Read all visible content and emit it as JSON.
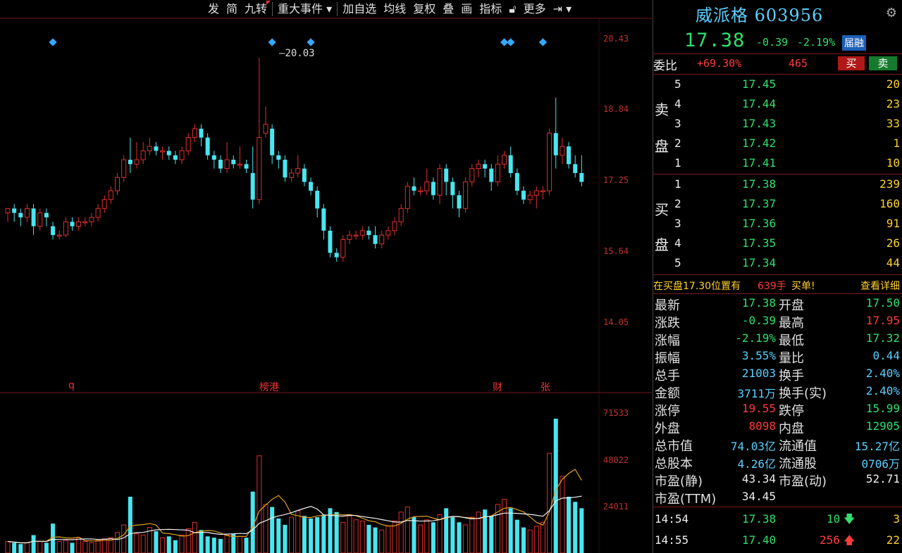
{
  "toolbar": {
    "items": [
      "发",
      "简",
      "九转",
      "重大事件",
      "加自选",
      "均线",
      "复权",
      "叠",
      "画",
      "指标",
      "更多"
    ],
    "dropdown_icon": "chevron-down-icon",
    "lock_icon": "lock-icon",
    "exit_icon": "exit-icon"
  },
  "header": {
    "stock_name": "威派格",
    "stock_code": "603956",
    "price": "17.38",
    "change": "-0.39",
    "change_pct": "-2.19%",
    "badge": "届融"
  },
  "order_book": {
    "weibi_label": "委比",
    "weibi_pct": "+69.30%",
    "weicha": "465",
    "buy_btn": "买",
    "sell_btn": "卖",
    "sell_side_label_1": "卖",
    "sell_side_label_2": "盘",
    "buy_side_label_1": "买",
    "buy_side_label_2": "盘",
    "asks": [
      {
        "level": "5",
        "price": "17.45",
        "vol": "20"
      },
      {
        "level": "4",
        "price": "17.44",
        "vol": "23"
      },
      {
        "level": "3",
        "price": "17.43",
        "vol": "33"
      },
      {
        "level": "2",
        "price": "17.42",
        "vol": "1"
      },
      {
        "level": "1",
        "price": "17.41",
        "vol": "10"
      }
    ],
    "bids": [
      {
        "level": "1",
        "price": "17.38",
        "vol": "239"
      },
      {
        "level": "2",
        "price": "17.37",
        "vol": "160"
      },
      {
        "level": "3",
        "price": "17.36",
        "vol": "91"
      },
      {
        "level": "4",
        "price": "17.35",
        "vol": "26"
      },
      {
        "level": "5",
        "price": "17.34",
        "vol": "44"
      }
    ]
  },
  "notice": {
    "prefix": "在买盘17.30位置有",
    "amount": "639手",
    "suffix": "买单!",
    "link": "查看详细"
  },
  "stats": [
    {
      "k": "最新",
      "v": "17.38",
      "c": "green"
    },
    {
      "k": "开盘",
      "v": "17.50",
      "c": "green"
    },
    {
      "k": "涨跌",
      "v": "-0.39",
      "c": "green"
    },
    {
      "k": "最高",
      "v": "17.95",
      "c": "red"
    },
    {
      "k": "涨幅",
      "v": "-2.19%",
      "c": "green"
    },
    {
      "k": "最低",
      "v": "17.32",
      "c": "green"
    },
    {
      "k": "振幅",
      "v": "3.55%",
      "c": "blue"
    },
    {
      "k": "量比",
      "v": "0.44",
      "c": "blue"
    },
    {
      "k": "总手",
      "v": "21003",
      "c": "blue"
    },
    {
      "k": "换手",
      "v": "2.40%",
      "c": "blue"
    },
    {
      "k": "金额",
      "v": "3711万",
      "c": "blue"
    },
    {
      "k": "换手(实)",
      "v": "2.40%",
      "c": "blue"
    },
    {
      "k": "涨停",
      "v": "19.55",
      "c": "red"
    },
    {
      "k": "跌停",
      "v": "15.99",
      "c": "green"
    },
    {
      "k": "外盘",
      "v": "8098",
      "c": "red"
    },
    {
      "k": "内盘",
      "v": "12905",
      "c": "green"
    },
    {
      "k": "总市值",
      "v": "74.03亿",
      "c": "blue"
    },
    {
      "k": "流通值",
      "v": "15.27亿",
      "c": "blue"
    },
    {
      "k": "总股本",
      "v": "4.26亿",
      "c": "blue"
    },
    {
      "k": "流通股",
      "v": "0706万",
      "c": "blue"
    },
    {
      "k": "市盈(静)",
      "v": "43.34",
      "c": "white"
    },
    {
      "k": "市盈(动)",
      "v": "52.71",
      "c": "white"
    },
    {
      "k": "市盈(TTM)",
      "v": "34.45",
      "c": "white"
    }
  ],
  "ticks": [
    {
      "time": "14:54",
      "price": "17.38",
      "vol": "10",
      "dir": "down",
      "n": "3"
    },
    {
      "time": "14:55",
      "price": "17.40",
      "vol": "256",
      "dir": "up",
      "n": "22"
    }
  ],
  "chart": {
    "price_labels": [
      "20.43",
      "18.84",
      "17.25",
      "15.64",
      "14.05"
    ],
    "volume_labels": [
      "71533",
      "48022",
      "24011"
    ],
    "high_marker": "20.03",
    "event_labels": [
      "q",
      "榜港",
      "财",
      "张"
    ]
  },
  "chart_data": {
    "type": "candlestick",
    "price_axis_ticks": [
      20.43,
      18.84,
      17.25,
      15.64,
      14.05
    ],
    "volume_axis_ticks": [
      71533,
      48022,
      24011
    ],
    "highest_marker": 20.03,
    "candles": [
      [
        16.5,
        16.6,
        16.3,
        16.6
      ],
      [
        16.6,
        16.5,
        16.3,
        16.7
      ],
      [
        16.5,
        16.4,
        16.2,
        16.6
      ],
      [
        16.4,
        16.6,
        16.3,
        16.7
      ],
      [
        16.6,
        16.2,
        16.0,
        16.7
      ],
      [
        16.2,
        16.5,
        16.1,
        16.6
      ],
      [
        16.5,
        16.4,
        16.2,
        16.6
      ],
      [
        16.2,
        16.0,
        15.9,
        16.3
      ],
      [
        16.0,
        16.0,
        15.9,
        16.1
      ],
      [
        16.0,
        16.3,
        15.95,
        16.4
      ],
      [
        16.3,
        16.2,
        16.1,
        16.4
      ],
      [
        16.2,
        16.3,
        16.1,
        16.4
      ],
      [
        16.3,
        16.3,
        16.2,
        16.4
      ],
      [
        16.3,
        16.4,
        16.2,
        16.5
      ],
      [
        16.4,
        16.6,
        16.3,
        16.7
      ],
      [
        16.6,
        16.8,
        16.5,
        16.9
      ],
      [
        16.8,
        17.0,
        16.7,
        17.1
      ],
      [
        17.0,
        17.3,
        16.9,
        17.4
      ],
      [
        17.3,
        17.7,
        17.2,
        17.8
      ],
      [
        17.7,
        17.6,
        17.4,
        18.2
      ],
      [
        17.6,
        17.7,
        17.5,
        18.1
      ],
      [
        17.7,
        17.9,
        17.6,
        18.1
      ],
      [
        17.9,
        18.0,
        17.8,
        18.2
      ],
      [
        18.0,
        17.9,
        17.8,
        18.1
      ],
      [
        17.9,
        17.9,
        17.7,
        18.0
      ],
      [
        17.9,
        17.8,
        17.7,
        18.0
      ],
      [
        17.8,
        17.7,
        17.6,
        17.9
      ],
      [
        17.7,
        17.9,
        17.6,
        18.0
      ],
      [
        17.9,
        18.2,
        17.8,
        18.3
      ],
      [
        18.2,
        18.4,
        18.1,
        18.5
      ],
      [
        18.4,
        18.2,
        18.0,
        18.5
      ],
      [
        18.2,
        17.8,
        17.7,
        18.3
      ],
      [
        17.8,
        17.7,
        17.5,
        17.9
      ],
      [
        17.7,
        17.5,
        17.4,
        17.8
      ],
      [
        17.5,
        17.7,
        17.4,
        18.1
      ],
      [
        17.7,
        17.6,
        17.5,
        17.8
      ],
      [
        17.6,
        17.6,
        17.5,
        18.0
      ],
      [
        17.6,
        17.5,
        17.4,
        17.7
      ],
      [
        17.4,
        16.8,
        16.6,
        18.0
      ],
      [
        16.8,
        18.2,
        16.7,
        20.0
      ],
      [
        18.3,
        18.5,
        18.2,
        18.9
      ],
      [
        18.4,
        17.8,
        17.6,
        18.5
      ],
      [
        17.8,
        17.7,
        17.5,
        17.9
      ],
      [
        17.7,
        17.3,
        17.2,
        17.8
      ],
      [
        17.3,
        17.4,
        17.2,
        17.5
      ],
      [
        17.4,
        17.5,
        17.3,
        17.8
      ],
      [
        17.5,
        17.2,
        17.1,
        17.6
      ],
      [
        17.2,
        17.0,
        16.9,
        17.3
      ],
      [
        17.0,
        16.6,
        16.4,
        17.1
      ],
      [
        16.6,
        16.1,
        15.9,
        16.7
      ],
      [
        16.1,
        15.6,
        15.5,
        16.2
      ],
      [
        15.6,
        15.5,
        15.4,
        15.7
      ],
      [
        15.5,
        15.9,
        15.4,
        16.0
      ],
      [
        15.9,
        16.0,
        15.8,
        16.1
      ],
      [
        16.0,
        16.0,
        15.9,
        16.1
      ],
      [
        16.0,
        16.1,
        15.9,
        16.2
      ],
      [
        16.1,
        16.0,
        15.9,
        16.2
      ],
      [
        16.0,
        15.8,
        15.7,
        16.2
      ],
      [
        15.8,
        16.0,
        15.7,
        16.1
      ],
      [
        16.0,
        16.1,
        15.9,
        16.2
      ],
      [
        16.1,
        16.3,
        16.0,
        16.4
      ],
      [
        16.3,
        16.6,
        16.2,
        16.7
      ],
      [
        16.6,
        17.1,
        16.5,
        17.2
      ],
      [
        17.1,
        17.0,
        16.9,
        17.3
      ],
      [
        17.0,
        17.0,
        16.9,
        17.1
      ],
      [
        17.0,
        17.2,
        16.9,
        17.5
      ],
      [
        17.2,
        16.9,
        16.8,
        17.3
      ],
      [
        16.9,
        17.5,
        16.7,
        17.6
      ],
      [
        17.5,
        17.2,
        16.9,
        17.6
      ],
      [
        17.2,
        16.9,
        16.6,
        17.3
      ],
      [
        16.9,
        16.6,
        16.4,
        17.0
      ],
      [
        16.6,
        17.2,
        16.5,
        17.3
      ],
      [
        17.2,
        17.5,
        17.1,
        17.6
      ],
      [
        17.5,
        17.6,
        17.3,
        17.7
      ],
      [
        17.6,
        17.5,
        17.3,
        17.7
      ],
      [
        17.5,
        17.2,
        17.0,
        17.6
      ],
      [
        17.2,
        17.6,
        17.1,
        17.8
      ],
      [
        17.6,
        17.8,
        17.5,
        17.9
      ],
      [
        17.8,
        17.4,
        17.3,
        18.0
      ],
      [
        17.4,
        17.0,
        16.9,
        17.5
      ],
      [
        17.0,
        16.8,
        16.7,
        17.1
      ],
      [
        16.8,
        16.9,
        16.7,
        17.0
      ],
      [
        16.9,
        17.0,
        16.6,
        17.1
      ],
      [
        17.0,
        17.0,
        16.8,
        17.1
      ],
      [
        17.0,
        18.3,
        16.9,
        18.4
      ],
      [
        18.3,
        17.8,
        17.5,
        19.1
      ],
      [
        17.8,
        18.0,
        17.6,
        18.2
      ],
      [
        18.0,
        17.6,
        17.5,
        18.1
      ],
      [
        17.6,
        17.4,
        17.3,
        17.8
      ],
      [
        17.4,
        17.2,
        17.1,
        17.8
      ]
    ],
    "volumes": [
      9,
      8,
      7,
      8,
      14,
      9,
      8,
      23,
      9,
      10,
      8,
      12,
      9,
      8,
      10,
      11,
      12,
      16,
      22,
      44,
      15,
      14,
      20,
      17,
      12,
      13,
      10,
      14,
      19,
      24,
      18,
      13,
      12,
      11,
      14,
      15,
      13,
      12,
      48,
      76,
      38,
      36,
      27,
      22,
      28,
      33,
      29,
      27,
      28,
      30,
      35,
      32,
      24,
      29,
      26,
      25,
      22,
      20,
      18,
      21,
      25,
      32,
      36,
      28,
      22,
      26,
      24,
      30,
      35,
      28,
      24,
      22,
      28,
      32,
      34,
      29,
      38,
      42,
      35,
      26,
      20,
      18,
      21,
      24,
      78,
      105,
      60,
      44,
      40,
      35
    ]
  }
}
